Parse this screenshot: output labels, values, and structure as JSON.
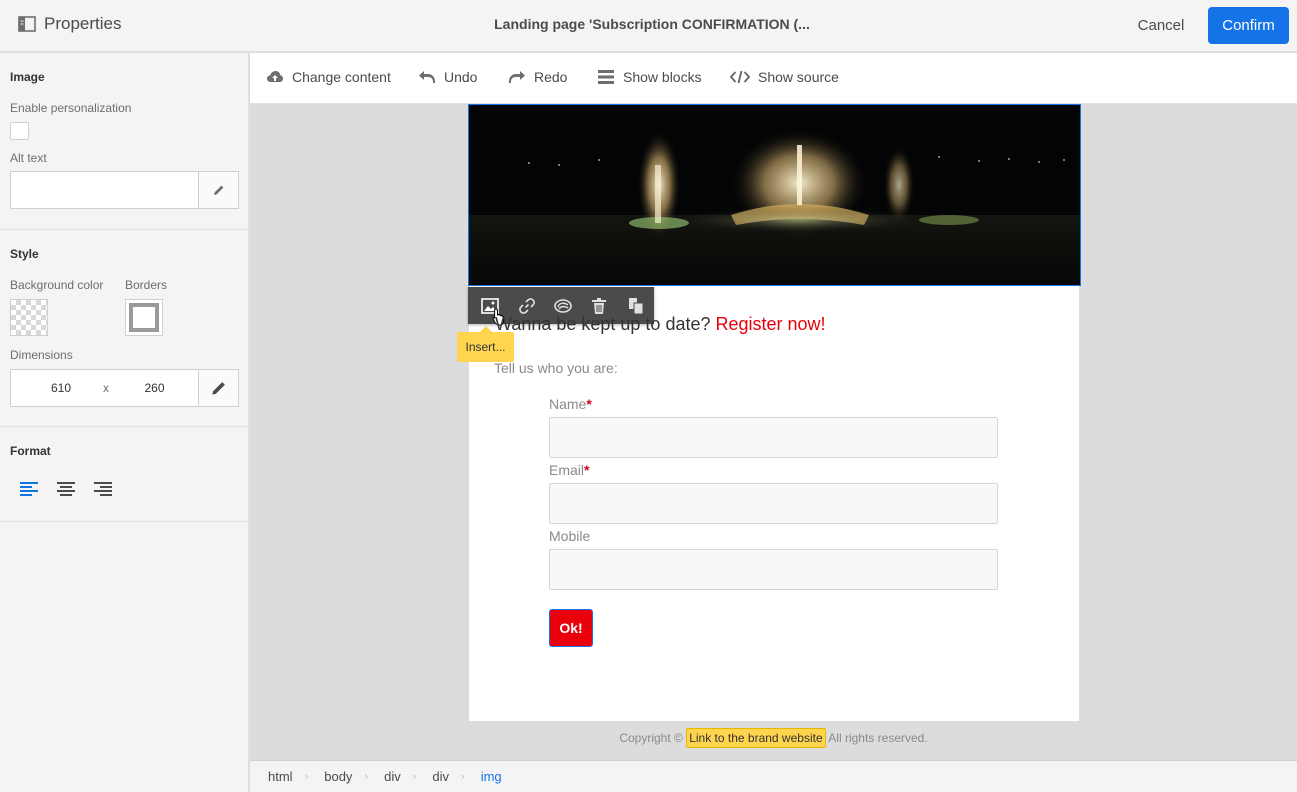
{
  "header": {
    "panel_title": "Properties",
    "document_title": "Landing page 'Subscription CONFIRMATION (...",
    "cancel_label": "Cancel",
    "confirm_label": "Confirm",
    "accent_color": "#1473e6"
  },
  "sidebar": {
    "image": {
      "title": "Image",
      "enable_personalization_label": "Enable personalization",
      "enable_personalization_checked": false,
      "alt_text_label": "Alt text",
      "alt_text_value": ""
    },
    "style": {
      "title": "Style",
      "background_color_label": "Background color",
      "borders_label": "Borders",
      "dimensions_label": "Dimensions",
      "width": "610",
      "separator": "x",
      "height": "260"
    },
    "format": {
      "title": "Format",
      "alignments": [
        "align-left",
        "align-center",
        "align-right"
      ],
      "active_alignment": "align-left"
    }
  },
  "toolbar": {
    "change_content": "Change content",
    "undo": "Undo",
    "redo": "Redo",
    "show_blocks": "Show blocks",
    "show_source": "Show source"
  },
  "canvas": {
    "image_toolbar": {
      "icons": [
        "image-icon",
        "link-icon",
        "adobe-cloud-icon",
        "trash-icon",
        "copy-icon"
      ],
      "tooltip": "Insert..."
    },
    "headline_prefix": "Wanna be kept up to date? ",
    "headline_link": "Register now!",
    "intro": "Tell us who you are:",
    "form": {
      "name_label": "Name",
      "email_label": "Email",
      "mobile_label": "Mobile",
      "required_mark": "*",
      "submit_label": "Ok!"
    },
    "footer": {
      "copyright_prefix": "Copyright ©",
      "link_text": "Link to the brand website",
      "suffix": "All rights reserved."
    }
  },
  "breadcrumb": {
    "items": [
      "html",
      "body",
      "div",
      "div",
      "img"
    ],
    "active": "img"
  }
}
